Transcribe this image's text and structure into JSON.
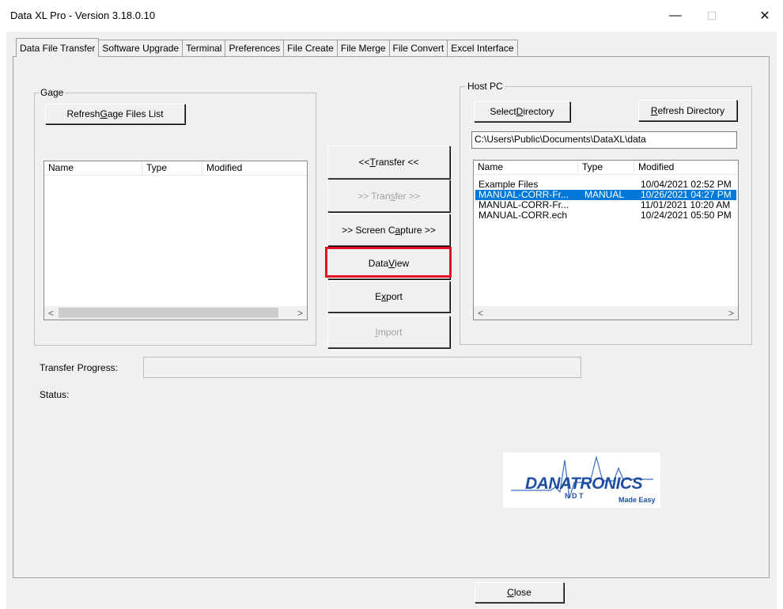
{
  "window": {
    "title": "Data XL Pro - Version 3.18.0.10",
    "minimize_glyph": "—",
    "maximize_glyph": "☐",
    "close_glyph": "✕"
  },
  "tabs": [
    {
      "label": "Data File Transfer",
      "active": true
    },
    {
      "label": "Software Upgrade"
    },
    {
      "label": "Terminal"
    },
    {
      "label": "Preferences"
    },
    {
      "label": "File Create"
    },
    {
      "label": "File Merge"
    },
    {
      "label": "File Convert"
    },
    {
      "label": "Excel Interface"
    }
  ],
  "gage": {
    "group_label": "Gage",
    "refresh_button": {
      "pre": "Refresh ",
      "accel": "G",
      "post": "age Files List"
    },
    "columns": [
      "Name",
      "Type",
      "Modified"
    ],
    "rows": []
  },
  "middle": {
    "transfer_left": {
      "pre": "<< ",
      "accel": "T",
      "post": "ransfer <<"
    },
    "transfer_right": {
      "pre": ">> Tran",
      "accel": "s",
      "post": "fer >>"
    },
    "screen_capture": {
      "pre": ">> Screen C",
      "accel": "a",
      "post": "pture >>"
    },
    "data_view": {
      "pre": "Data ",
      "accel": "V",
      "post": "iew"
    },
    "export": {
      "pre": "E",
      "accel": "x",
      "post": "port"
    },
    "import": {
      "pre": "",
      "accel": "I",
      "post": "mport"
    }
  },
  "host": {
    "group_label": "Host PC",
    "select_directory": {
      "pre": "Select ",
      "accel": "D",
      "post": "irectory"
    },
    "refresh_directory": {
      "pre": "",
      "accel": "R",
      "post": "efresh Directory"
    },
    "path": "C:\\Users\\Public\\Documents\\DataXL\\data",
    "columns": [
      "Name",
      "Type",
      "Modified"
    ],
    "rows": [
      {
        "name": "Example Files",
        "type": "",
        "modified": "10/04/2021 02:52 PM",
        "selected": false
      },
      {
        "name": "MANUAL-CORR-Fr...",
        "type": "MANUAL",
        "modified": "10/26/2021 04:27 PM",
        "selected": true
      },
      {
        "name": "MANUAL-CORR-Fr...",
        "type": "",
        "modified": "11/01/2021 10:20 AM",
        "selected": false
      },
      {
        "name": "MANUAL-CORR.ech",
        "type": "",
        "modified": "10/24/2021 05:50 PM",
        "selected": false
      }
    ]
  },
  "progress": {
    "label": "Transfer Progress:",
    "value": 0
  },
  "status": {
    "label": "Status:"
  },
  "logo": {
    "text": "DANATRONICS",
    "sub1": "N D T",
    "sub2": "Made Easy"
  },
  "footer": {
    "close": {
      "pre": "",
      "accel": "C",
      "post": "lose"
    }
  },
  "colors": {
    "selection": "#0078d7",
    "highlight": "#e81123",
    "logo_blue": "#1f4fa3"
  }
}
